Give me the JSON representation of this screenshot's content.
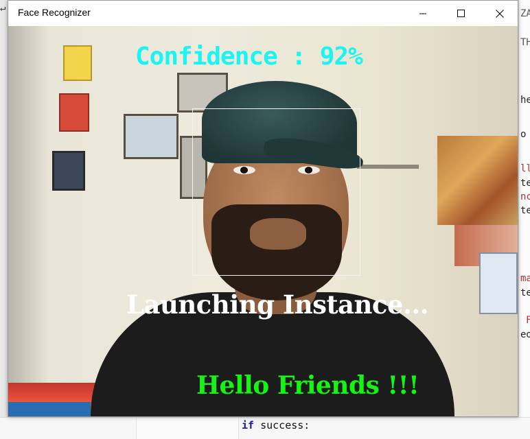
{
  "window": {
    "title": "Face Recognizer",
    "minimize_icon": "minimize-icon",
    "maximize_icon": "maximize-icon",
    "close_icon": "close-icon"
  },
  "overlay": {
    "confidence_text": "Confidence : 92%",
    "status_text": "Launching Instance...",
    "greeting_text": "Hello Friends !!!",
    "colors": {
      "confidence": "#19f5f2",
      "status": "#ffffff",
      "greeting": "#14f514",
      "face_box": "#f2f2f2"
    }
  },
  "background_editor": {
    "left_glyph": "↵",
    "right_fragments": [
      "ZA",
      "TH",
      "he",
      "o",
      "ll",
      "te",
      "nc",
      "te",
      "ma",
      "te",
      "F",
      "ed"
    ],
    "code_line": {
      "keyword": "if",
      "rest": " success:"
    }
  }
}
